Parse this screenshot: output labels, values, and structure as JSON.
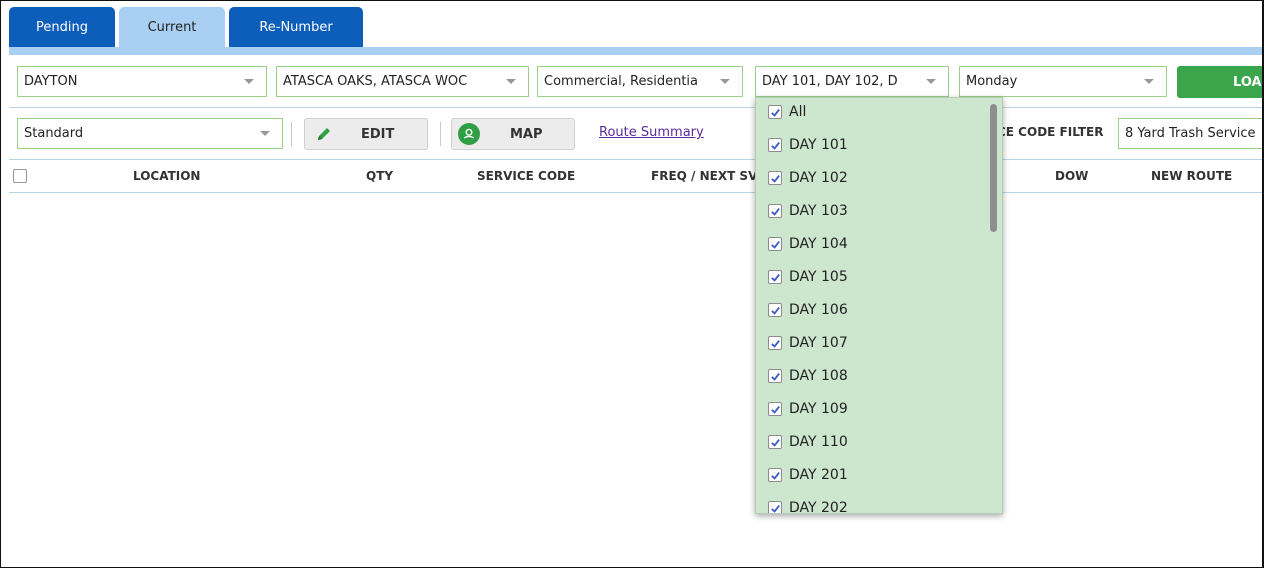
{
  "tabs": [
    {
      "label": "Pending"
    },
    {
      "label": "Current"
    },
    {
      "label": "Re-Number"
    }
  ],
  "filters": {
    "division": "DAYTON",
    "subdivision": "ATASCA OAKS, ATASCA WOC",
    "category": "Commercial, Residentia",
    "route": "DAY 101, DAY 102, D",
    "day": "Monday",
    "load_label": "LOAD"
  },
  "toolbar": {
    "view": "Standard",
    "edit_label": "EDIT",
    "map_label": "MAP",
    "route_summary_label": "Route Summary",
    "service_code_filter_label": "CE CODE FILTER",
    "service_code_filter_value": "8 Yard Trash Service"
  },
  "table": {
    "columns": [
      "LOCATION",
      "QTY",
      "SERVICE CODE",
      "FREQ / NEXT SV",
      "DOW",
      "NEW ROUTE"
    ]
  },
  "route_dropdown": {
    "options": [
      "All",
      "DAY 101",
      "DAY 102",
      "DAY 103",
      "DAY 104",
      "DAY 105",
      "DAY 106",
      "DAY 107",
      "DAY 108",
      "DAY 109",
      "DAY 110",
      "DAY 201",
      "DAY 202"
    ]
  },
  "colors": {
    "tab_dark": "#0d5dbb",
    "tab_light": "#a9d0f3",
    "load_green": "#3aa54a",
    "dropdown_bg": "#cde6ce",
    "checkbox_check": "#3b5bc9"
  },
  "icons": {
    "edit": "pencil-icon",
    "map": "map-pin-icon",
    "caret": "chevron-down-icon",
    "check": "check-icon"
  }
}
